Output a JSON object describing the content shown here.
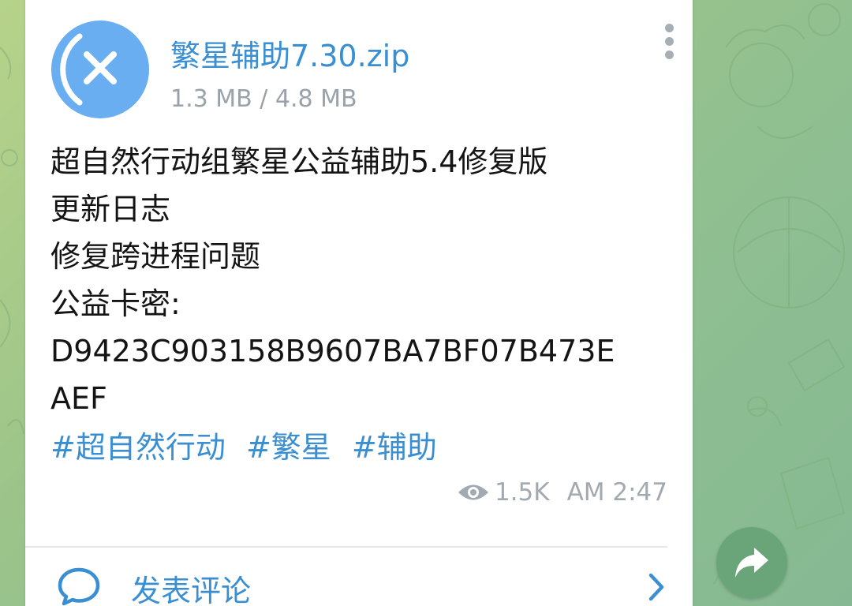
{
  "file": {
    "name": "繁星辅助7.30.zip",
    "size": "1.3 MB / 4.8 MB",
    "icon": "cancel-download-icon"
  },
  "message": {
    "lines": [
      "超自然行动组繁星公益辅助5.4修复版",
      "更新日志",
      "修复跨进程问题",
      "公益卡密:",
      "D9423C903158B9607BA7BF07B473E",
      "AEF"
    ],
    "hashtags": [
      "#超自然行动",
      "#繁星",
      "#辅助"
    ]
  },
  "meta": {
    "views": "1.5K",
    "time": "AM 2:47"
  },
  "comments": {
    "label": "发表评论"
  },
  "colors": {
    "accent": "#3a8fd3",
    "file_icon_bg": "#68aef0",
    "share_button_bg": "#6aa57a",
    "bubble_bg": "#ffffff"
  }
}
